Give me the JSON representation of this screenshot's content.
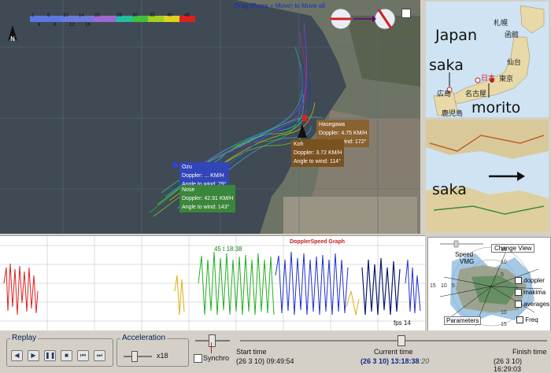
{
  "map": {
    "hint": "Drag (Press + Move) to Move all",
    "legend_top": [
      "2",
      "6",
      "10",
      "14",
      "20",
      "26",
      "30",
      "35",
      "40",
      "45"
    ],
    "legend_bottom": [
      "4",
      "8",
      "12",
      "16"
    ],
    "tags": [
      {
        "name": "Hasegawa",
        "doppler": "Doppler: 4.75 KM/H",
        "angle": "Angle to wind: 172°",
        "color": "#9a6a2a"
      },
      {
        "name": "Koh",
        "doppler": "Doppler: 3.72 KM/H",
        "angle": "Angle to wind: 114°",
        "color": "#8a5a20"
      },
      {
        "name": "Ozu",
        "doppler": "Doppler: ... KM/H",
        "angle": "Angle to wind: 79°",
        "color": "#3a4ec0"
      },
      {
        "name": "Nose",
        "doppler": "Doppler: 42.91 KM/H",
        "angle": "Angle to wind: 143°",
        "color": "#3f8f3f"
      }
    ],
    "colors": {
      "red": "#e02020",
      "yellow": "#e0c010",
      "green": "#20b020",
      "blue": "#2030d0",
      "navy": "#0a1a6a",
      "cyan": "#20c0d0",
      "magenta": "#c020a0",
      "lime": "#60e040"
    }
  },
  "side": {
    "japan_label": "Japan",
    "saka_label": "saka",
    "morito_label": "morito",
    "cities": [
      "札幌",
      "函館",
      "仙台",
      "東京",
      "日本",
      "名古屋",
      "広島",
      "鹿児島"
    ],
    "saka2_label": "saka"
  },
  "graph": {
    "title": "DopplerSpeed Graph",
    "top_left": "45 t 18:38",
    "bottom_right": "fps 14"
  },
  "polar": {
    "change_view": "Change View",
    "speed": "Speed",
    "vmg": "VMG",
    "doppler": "doppler",
    "makima": "makima",
    "averages": "averages",
    "parameters": "Parameters",
    "freq": "Freq",
    "ticks": [
      "15",
      "10",
      "5",
      "15",
      "10",
      "5",
      "10",
      "15"
    ]
  },
  "controls": {
    "replay": "Replay",
    "acceleration": "Acceleration",
    "accel_value": "x18",
    "synchro": "Synchro",
    "start_label": "Start time",
    "start_value": "(26 3 10) 09:49:54",
    "current_label": "Current time",
    "current_value": "(26 3 10) 13:18:38",
    "current_suffix": ":20",
    "finish_label": "Finish time",
    "finish_value": "(26 3 10) 16:29:03"
  }
}
